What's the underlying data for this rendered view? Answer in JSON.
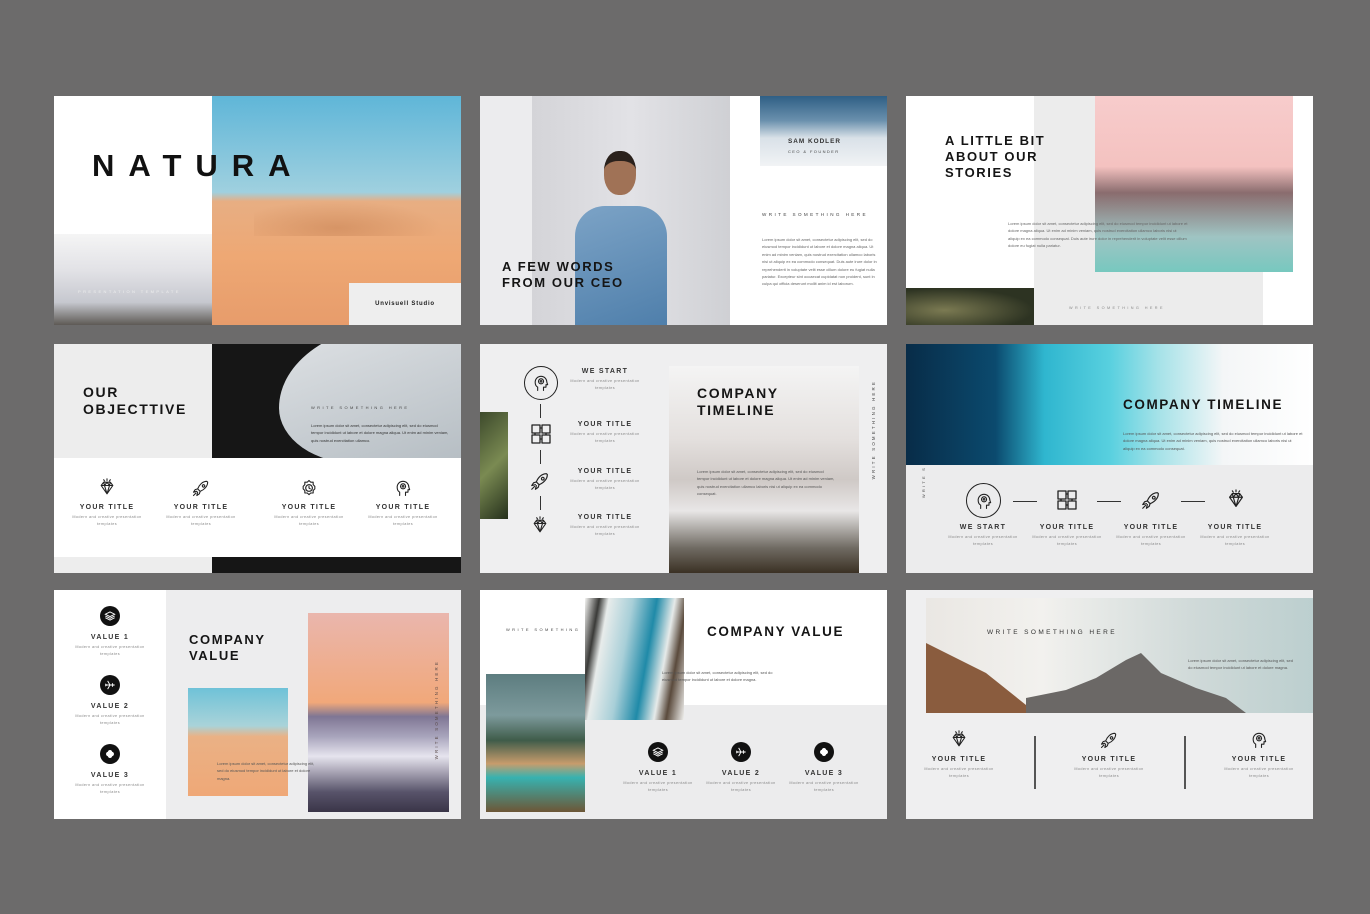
{
  "colors": {
    "background": "#6c6b6b",
    "slide_grey": "#ededed",
    "text": "#151515"
  },
  "slides": [
    {
      "title": "NATURA",
      "subtitle": "PRESENTATION TEMPLATE",
      "studio": "Unvisuell Studio"
    },
    {
      "title_1": "A FEW WORDS",
      "title_2": "FROM OUR CEO",
      "name": "SAM KODLER",
      "role": "CEO & FOUNDER",
      "heading": "WRITE SOMETHING HERE",
      "body": "Lorem ipsum dolor sit amet, consectetur adipiscing elit, sed do eiusmod tempor incididunt ut labore et dolore magna aliqua. Ut enim ad minim veniam, quis nostrud exercitation ullamco laboris nisi ut aliquip ex ea commodo consequat. Duis aute irure dolor in reprehenderit in voluptate velit esse cillum dolore eu fugiat nulla pariatur. Excepteur sint occaecat cupidatat non proident, sunt in culpa qui officia deserunt mollit anim id est laborum."
    },
    {
      "title_1": "A LITTLE BIT",
      "title_2": "ABOUT OUR",
      "title_3": "STORIES",
      "body": "Lorem ipsum dolor sit amet, consectetur adipiscing elit, sed do eiusmod tempor incididunt ut labore et dolore magna aliqua. Ut enim ad minim veniam, quis nostrud exercitation ullamco laboris nisi ut aliquip ex ea commodo consequat. Duis aute irure dolor in reprehenderit in voluptate velit esse cillum dolore eu fugiat nulla pariatur.",
      "footer": "WRITE SOMETHING HERE"
    },
    {
      "title_1": "OUR",
      "title_2": "OBJECTTIVE",
      "heading": "WRITE SOMETHING HERE",
      "body": "Lorem ipsum dolor sit amet, consectetur adipiscing elit, sed do eiusmod tempor incididunt ut labore et dolore magna aliqua. Ut enim ad minim veniam, quis nostrud exercitation ullamco.",
      "items": [
        {
          "icon": "diamond",
          "title": "YOUR TITLE",
          "desc": "Modern and creative presentation templates"
        },
        {
          "icon": "rocket",
          "title": "YOUR TITLE",
          "desc": "Modern and creative presentation templates"
        },
        {
          "icon": "gear",
          "title": "YOUR TITLE",
          "desc": "Modern and creative presentation templates"
        },
        {
          "icon": "head",
          "title": "YOUR TITLE",
          "desc": "Modern and creative presentation templates"
        }
      ]
    },
    {
      "title_1": "COMPANY",
      "title_2": "TIMELINE",
      "vertical": "WRITE SOMETHING HERE",
      "body": "Lorem ipsum dolor sit amet, consectetur adipiscing elit, sed do eiusmod tempor incididunt ut labore et dolore magna aliqua. Ut enim ad minim veniam, quis nostrud exercitation ullamco laboris nisi ut aliquip ex ea commodo consequat.",
      "items": [
        {
          "icon": "head",
          "title": "WE START",
          "desc": "Modern and creative presentation templates"
        },
        {
          "icon": "puzzle",
          "title": "YOUR TITLE",
          "desc": "Modern and creative presentation templates"
        },
        {
          "icon": "rocket",
          "title": "YOUR TITLE",
          "desc": "Modern and creative presentation templates"
        },
        {
          "icon": "diamond",
          "title": "YOUR TITLE",
          "desc": "Modern and creative presentation templates"
        }
      ]
    },
    {
      "title": "COMPANY TIMELINE",
      "vertical": "WRITE S",
      "body": "Lorem ipsum dolor sit amet, consectetur adipiscing elit, sed do eiusmod tempor incididunt ut labore et dolore magna aliqua. Ut enim ad minim veniam, quis nostrud exercitation ullamco laboris nisi ut aliquip ex ea commodo consequat.",
      "items": [
        {
          "icon": "head",
          "title": "WE START",
          "desc": "Modern and creative presentation templates"
        },
        {
          "icon": "puzzle",
          "title": "YOUR TITLE",
          "desc": "Modern and creative presentation templates"
        },
        {
          "icon": "rocket",
          "title": "YOUR TITLE",
          "desc": "Modern and creative presentation templates"
        },
        {
          "icon": "diamond",
          "title": "YOUR TITLE",
          "desc": "Modern and creative presentation templates"
        }
      ]
    },
    {
      "title_1": "COMPANY",
      "title_2": "VALUE",
      "vertical": "WRITE SOMETHING HERE",
      "body": "Lorem ipsum dolor sit amet, consectetur adipiscing elit, sed do eiusmod tempor incididunt ut labore et dolore magna.",
      "values": [
        {
          "icon": "layers",
          "title": "VALUE 1",
          "desc": "Modern and creative presentation templates"
        },
        {
          "icon": "plane",
          "title": "VALUE 2",
          "desc": "Modern and creative presentation templates"
        },
        {
          "icon": "flower",
          "title": "VALUE 3",
          "desc": "Modern and creative presentation templates"
        }
      ]
    },
    {
      "title": "COMPANY VALUE",
      "heading": "WRITE SOMETHING",
      "body": "Lorem ipsum dolor sit amet, consectetur adipiscing elit, sed do eiusmod tempor incididunt ut labore et dolore magna.",
      "values": [
        {
          "icon": "layers",
          "title": "VALUE 1",
          "desc": "Modern and creative presentation templates"
        },
        {
          "icon": "plane",
          "title": "VALUE 2",
          "desc": "Modern and creative presentation templates"
        },
        {
          "icon": "flower",
          "title": "VALUE 3",
          "desc": "Modern and creative presentation templates"
        }
      ]
    },
    {
      "heading": "WRITE SOMETHING HERE",
      "body": "Lorem ipsum dolor sit amet, consectetur adipiscing elit, sed do eiusmod tempor incididunt ut labore et dolore magna.",
      "items": [
        {
          "icon": "diamond",
          "title": "YOUR TITLE",
          "desc": "Modern and creative presentation templates"
        },
        {
          "icon": "rocket",
          "title": "YOUR TITLE",
          "desc": "Modern and creative presentation templates"
        },
        {
          "icon": "head",
          "title": "YOUR TITLE",
          "desc": "Modern and creative presentation templates"
        }
      ]
    }
  ]
}
